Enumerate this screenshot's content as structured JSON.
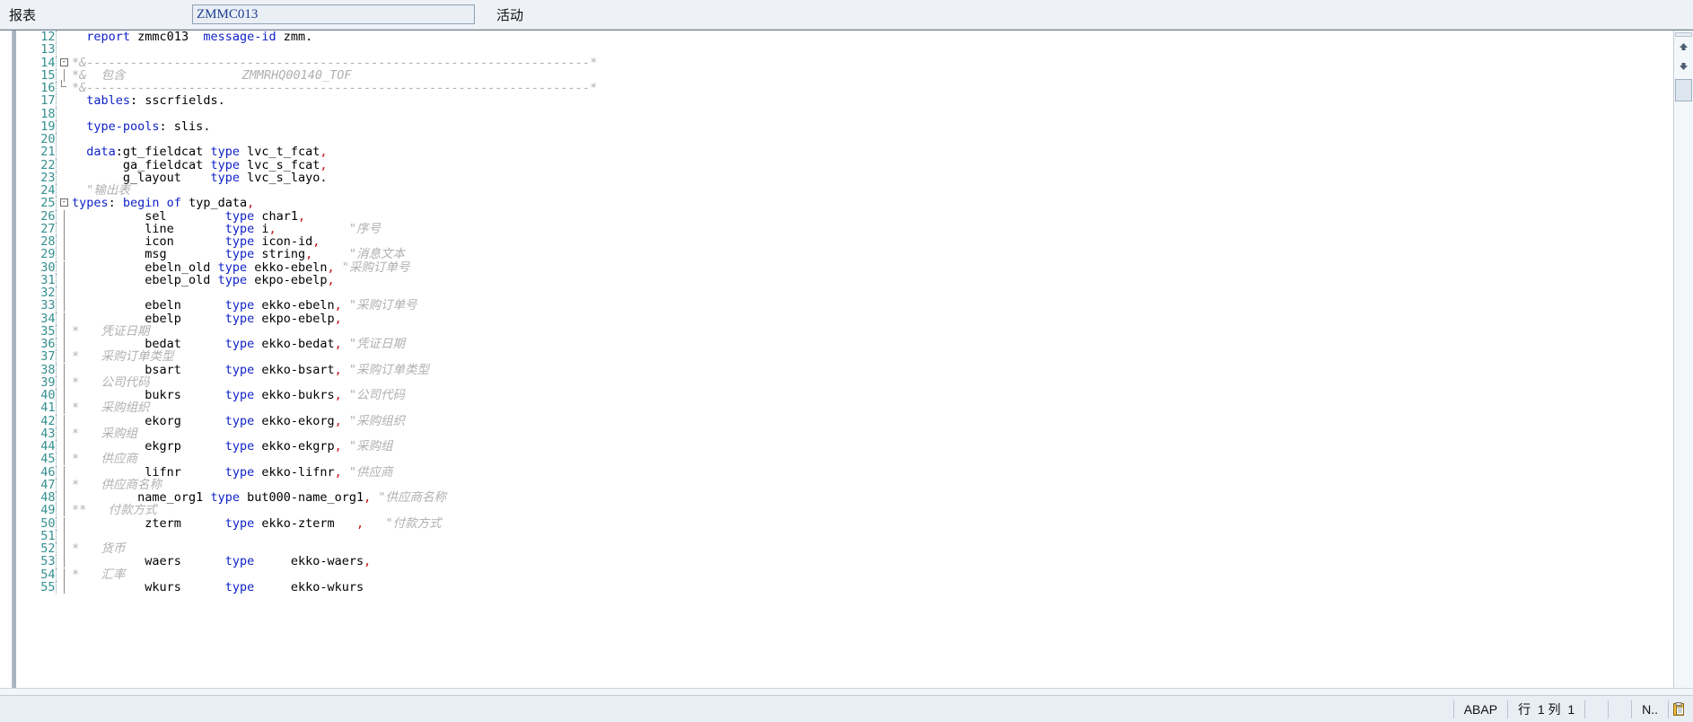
{
  "toolbar": {
    "report_label": "报表",
    "report_value": "ZMMC013",
    "status_label": "活动"
  },
  "editor": {
    "language": "ABAP",
    "lines": [
      {
        "n": "12",
        "fold": "",
        "tokens": [
          {
            "t": "  ",
            "c": "plain"
          },
          {
            "t": "report",
            "c": "kw"
          },
          {
            "t": " zmmc013  ",
            "c": "plain"
          },
          {
            "t": "message-id",
            "c": "kw"
          },
          {
            "t": " zmm.",
            "c": "plain"
          }
        ]
      },
      {
        "n": "13",
        "fold": "",
        "tokens": []
      },
      {
        "n": "14",
        "fold": "box",
        "tokens": [
          {
            "t": "*&---------------------------------------------------------------------*",
            "c": "cmt"
          }
        ]
      },
      {
        "n": "15",
        "fold": "bar",
        "tokens": [
          {
            "t": "*&  包含                ",
            "c": "cmt"
          },
          {
            "t": "ZMMRHQ00140_TOF",
            "c": "cmt"
          }
        ]
      },
      {
        "n": "16",
        "fold": "end",
        "tokens": [
          {
            "t": "*&---------------------------------------------------------------------*",
            "c": "cmt"
          }
        ]
      },
      {
        "n": "17",
        "fold": "",
        "tokens": [
          {
            "t": "  ",
            "c": "plain"
          },
          {
            "t": "tables",
            "c": "kw"
          },
          {
            "t": ": sscrfields.",
            "c": "plain"
          }
        ]
      },
      {
        "n": "18",
        "fold": "",
        "tokens": []
      },
      {
        "n": "19",
        "fold": "",
        "tokens": [
          {
            "t": "  ",
            "c": "plain"
          },
          {
            "t": "type-pools",
            "c": "kw"
          },
          {
            "t": ": slis.",
            "c": "plain"
          }
        ]
      },
      {
        "n": "20",
        "fold": "",
        "tokens": []
      },
      {
        "n": "21",
        "fold": "",
        "tokens": [
          {
            "t": "  ",
            "c": "plain"
          },
          {
            "t": "data",
            "c": "kw"
          },
          {
            "t": ":gt_fieldcat ",
            "c": "plain"
          },
          {
            "t": "type",
            "c": "kw"
          },
          {
            "t": " lvc_t_fcat",
            "c": "plain"
          },
          {
            "t": ",",
            "c": "pun"
          }
        ]
      },
      {
        "n": "22",
        "fold": "",
        "tokens": [
          {
            "t": "       ga_fieldcat ",
            "c": "plain"
          },
          {
            "t": "type",
            "c": "kw"
          },
          {
            "t": " lvc_s_fcat",
            "c": "plain"
          },
          {
            "t": ",",
            "c": "pun"
          }
        ]
      },
      {
        "n": "23",
        "fold": "",
        "tokens": [
          {
            "t": "       g_layout    ",
            "c": "plain"
          },
          {
            "t": "type",
            "c": "kw"
          },
          {
            "t": " lvc_s_layo.",
            "c": "plain"
          }
        ]
      },
      {
        "n": "24",
        "fold": "",
        "tokens": [
          {
            "t": "  \"输出表",
            "c": "cmt"
          }
        ]
      },
      {
        "n": "25",
        "fold": "box",
        "tokens": [
          {
            "t": "types",
            "c": "kw"
          },
          {
            "t": ": ",
            "c": "plain"
          },
          {
            "t": "begin of",
            "c": "kw"
          },
          {
            "t": " typ_data",
            "c": "plain"
          },
          {
            "t": ",",
            "c": "pun"
          }
        ]
      },
      {
        "n": "26",
        "fold": "bar",
        "tokens": [
          {
            "t": "          sel        ",
            "c": "plain"
          },
          {
            "t": "type",
            "c": "kw"
          },
          {
            "t": " char1",
            "c": "plain"
          },
          {
            "t": ",",
            "c": "pun"
          }
        ]
      },
      {
        "n": "27",
        "fold": "bar",
        "tokens": [
          {
            "t": "          line       ",
            "c": "plain"
          },
          {
            "t": "type",
            "c": "kw"
          },
          {
            "t": " i",
            "c": "plain"
          },
          {
            "t": ",",
            "c": "pun"
          },
          {
            "t": "          \"序号",
            "c": "cmt"
          }
        ]
      },
      {
        "n": "28",
        "fold": "bar",
        "tokens": [
          {
            "t": "          icon       ",
            "c": "plain"
          },
          {
            "t": "type",
            "c": "kw"
          },
          {
            "t": " icon-id",
            "c": "plain"
          },
          {
            "t": ",",
            "c": "pun"
          }
        ]
      },
      {
        "n": "29",
        "fold": "bar",
        "tokens": [
          {
            "t": "          msg        ",
            "c": "plain"
          },
          {
            "t": "type",
            "c": "kw"
          },
          {
            "t": " string",
            "c": "plain"
          },
          {
            "t": ",",
            "c": "pun"
          },
          {
            "t": "     \"消息文本",
            "c": "cmt"
          }
        ]
      },
      {
        "n": "30",
        "fold": "bar",
        "tokens": [
          {
            "t": "          ebeln_old ",
            "c": "plain"
          },
          {
            "t": "type",
            "c": "kw"
          },
          {
            "t": " ekko-ebeln",
            "c": "plain"
          },
          {
            "t": ",",
            "c": "pun"
          },
          {
            "t": " \"采购订单号",
            "c": "cmt"
          }
        ]
      },
      {
        "n": "31",
        "fold": "bar",
        "tokens": [
          {
            "t": "          ebelp_old ",
            "c": "plain"
          },
          {
            "t": "type",
            "c": "kw"
          },
          {
            "t": " ekpo-ebelp",
            "c": "plain"
          },
          {
            "t": ",",
            "c": "pun"
          }
        ]
      },
      {
        "n": "32",
        "fold": "bar",
        "tokens": []
      },
      {
        "n": "33",
        "fold": "bar",
        "tokens": [
          {
            "t": "          ebeln      ",
            "c": "plain"
          },
          {
            "t": "type",
            "c": "kw"
          },
          {
            "t": " ekko-ebeln",
            "c": "plain"
          },
          {
            "t": ",",
            "c": "pun"
          },
          {
            "t": " \"采购订单号",
            "c": "cmt"
          }
        ]
      },
      {
        "n": "34",
        "fold": "bar",
        "tokens": [
          {
            "t": "          ebelp      ",
            "c": "plain"
          },
          {
            "t": "type",
            "c": "kw"
          },
          {
            "t": " ekpo-ebelp",
            "c": "plain"
          },
          {
            "t": ",",
            "c": "pun"
          }
        ]
      },
      {
        "n": "35",
        "fold": "bar",
        "tokens": [
          {
            "t": "*   凭证日期",
            "c": "cmt"
          }
        ]
      },
      {
        "n": "36",
        "fold": "bar",
        "tokens": [
          {
            "t": "          bedat      ",
            "c": "plain"
          },
          {
            "t": "type",
            "c": "kw"
          },
          {
            "t": " ekko-bedat",
            "c": "plain"
          },
          {
            "t": ",",
            "c": "pun"
          },
          {
            "t": " \"凭证日期",
            "c": "cmt"
          }
        ]
      },
      {
        "n": "37",
        "fold": "bar",
        "tokens": [
          {
            "t": "*   采购订单类型",
            "c": "cmt"
          }
        ]
      },
      {
        "n": "38",
        "fold": "bar",
        "tokens": [
          {
            "t": "          bsart      ",
            "c": "plain"
          },
          {
            "t": "type",
            "c": "kw"
          },
          {
            "t": " ekko-bsart",
            "c": "plain"
          },
          {
            "t": ",",
            "c": "pun"
          },
          {
            "t": " \"采购订单类型",
            "c": "cmt"
          }
        ]
      },
      {
        "n": "39",
        "fold": "bar",
        "tokens": [
          {
            "t": "*   公司代码",
            "c": "cmt"
          }
        ]
      },
      {
        "n": "40",
        "fold": "bar",
        "tokens": [
          {
            "t": "          bukrs      ",
            "c": "plain"
          },
          {
            "t": "type",
            "c": "kw"
          },
          {
            "t": " ekko-bukrs",
            "c": "plain"
          },
          {
            "t": ",",
            "c": "pun"
          },
          {
            "t": " \"公司代码",
            "c": "cmt"
          }
        ]
      },
      {
        "n": "41",
        "fold": "bar",
        "tokens": [
          {
            "t": "*   采购组织",
            "c": "cmt"
          }
        ]
      },
      {
        "n": "42",
        "fold": "bar",
        "tokens": [
          {
            "t": "          ekorg      ",
            "c": "plain"
          },
          {
            "t": "type",
            "c": "kw"
          },
          {
            "t": " ekko-ekorg",
            "c": "plain"
          },
          {
            "t": ",",
            "c": "pun"
          },
          {
            "t": " \"采购组织",
            "c": "cmt"
          }
        ]
      },
      {
        "n": "43",
        "fold": "bar",
        "tokens": [
          {
            "t": "*   采购组",
            "c": "cmt"
          }
        ]
      },
      {
        "n": "44",
        "fold": "bar",
        "tokens": [
          {
            "t": "          ekgrp      ",
            "c": "plain"
          },
          {
            "t": "type",
            "c": "kw"
          },
          {
            "t": " ekko-ekgrp",
            "c": "plain"
          },
          {
            "t": ",",
            "c": "pun"
          },
          {
            "t": " \"采购组",
            "c": "cmt"
          }
        ]
      },
      {
        "n": "45",
        "fold": "bar",
        "tokens": [
          {
            "t": "*   供应商",
            "c": "cmt"
          }
        ]
      },
      {
        "n": "46",
        "fold": "bar",
        "tokens": [
          {
            "t": "          lifnr      ",
            "c": "plain"
          },
          {
            "t": "type",
            "c": "kw"
          },
          {
            "t": " ekko-lifnr",
            "c": "plain"
          },
          {
            "t": ",",
            "c": "pun"
          },
          {
            "t": " \"供应商",
            "c": "cmt"
          }
        ]
      },
      {
        "n": "47",
        "fold": "bar",
        "tokens": [
          {
            "t": "*   供应商名称",
            "c": "cmt"
          }
        ]
      },
      {
        "n": "48",
        "fold": "bar",
        "tokens": [
          {
            "t": "         name_org1 ",
            "c": "plain"
          },
          {
            "t": "type",
            "c": "kw"
          },
          {
            "t": " but000-name_org1",
            "c": "plain"
          },
          {
            "t": ",",
            "c": "pun"
          },
          {
            "t": " \"供应商名称",
            "c": "cmt"
          }
        ]
      },
      {
        "n": "49",
        "fold": "bar",
        "tokens": [
          {
            "t": "**   付款方式",
            "c": "cmt"
          }
        ]
      },
      {
        "n": "50",
        "fold": "bar",
        "tokens": [
          {
            "t": "          zterm      ",
            "c": "plain"
          },
          {
            "t": "type",
            "c": "kw"
          },
          {
            "t": " ekko-zterm   ",
            "c": "plain"
          },
          {
            "t": ",",
            "c": "pun"
          },
          {
            "t": "   \"付款方式",
            "c": "cmt"
          }
        ]
      },
      {
        "n": "51",
        "fold": "bar",
        "tokens": []
      },
      {
        "n": "52",
        "fold": "bar",
        "tokens": [
          {
            "t": "*   货币",
            "c": "cmt"
          }
        ]
      },
      {
        "n": "53",
        "fold": "bar",
        "tokens": [
          {
            "t": "          waers      ",
            "c": "plain"
          },
          {
            "t": "type",
            "c": "kw"
          },
          {
            "t": "     ekko-waers",
            "c": "plain"
          },
          {
            "t": ",",
            "c": "pun"
          }
        ]
      },
      {
        "n": "54",
        "fold": "bar",
        "tokens": [
          {
            "t": "*   汇率",
            "c": "cmt"
          }
        ]
      },
      {
        "n": "55",
        "fold": "bar",
        "tokens": [
          {
            "t": "          wkurs      ",
            "c": "plain"
          },
          {
            "t": "type",
            "c": "kw"
          },
          {
            "t": "     ekko-wkurs",
            "c": "plain"
          }
        ]
      }
    ]
  },
  "scrollbar": {
    "up_icon": "scroll-up-icon",
    "down_icon": "scroll-down-icon"
  },
  "statusbar": {
    "language": "ABAP",
    "row_label": "行",
    "row_value": "1",
    "col_label": "列",
    "col_value": "1",
    "system": "N..",
    "clipboard_icon": "clipboard-icon"
  }
}
